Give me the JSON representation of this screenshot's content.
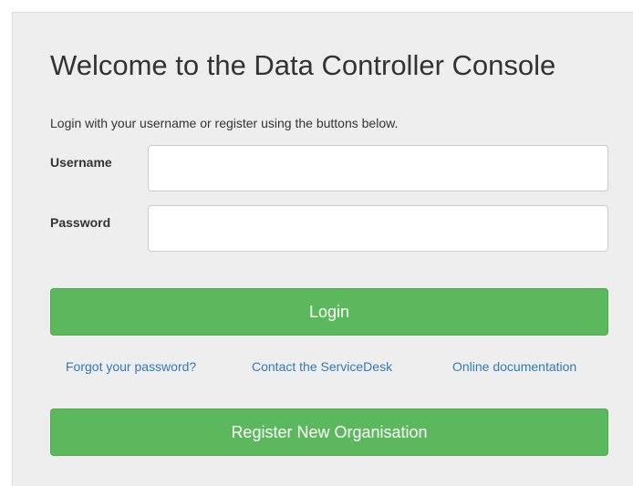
{
  "page": {
    "title": "Welcome to the Data Controller Console",
    "intro": "Login with your username or register using the buttons below."
  },
  "form": {
    "username_label": "Username",
    "username_value": "",
    "password_label": "Password",
    "password_value": "",
    "login_label": "Login"
  },
  "links": {
    "forgot_password": "Forgot your password?",
    "contact_servicedesk": "Contact the ServiceDesk",
    "online_documentation": "Online documentation"
  },
  "register": {
    "label": "Register New Organisation"
  },
  "colors": {
    "primary_button": "#5cb85c",
    "link": "#337ab7",
    "panel_background": "#eeeeee"
  }
}
